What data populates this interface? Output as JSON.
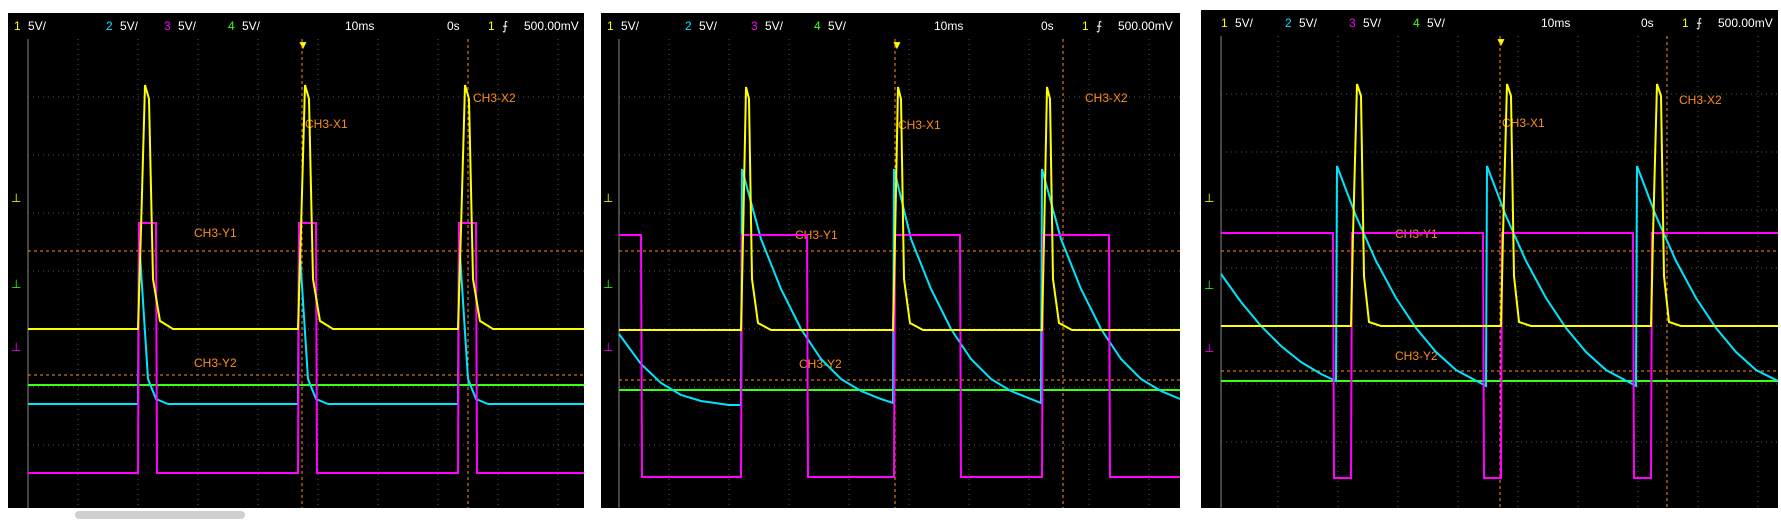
{
  "panels": [
    {
      "channels": [
        {
          "num": "1",
          "scale": "5V/"
        },
        {
          "num": "2",
          "scale": "5V/"
        },
        {
          "num": "3",
          "scale": "5V/"
        },
        {
          "num": "4",
          "scale": "5V/"
        }
      ],
      "timebase": "10ms",
      "delay": "0s",
      "trig_channel": "1",
      "trig_level": "500.00mV",
      "cursors": {
        "x1": "CH3-X1",
        "x2": "CH3-X2",
        "y1": "CH3-Y1",
        "y2": "CH3-Y2"
      }
    },
    {
      "channels": [
        {
          "num": "1",
          "scale": "5V/"
        },
        {
          "num": "2",
          "scale": "5V/"
        },
        {
          "num": "3",
          "scale": "5V/"
        },
        {
          "num": "4",
          "scale": "5V/"
        }
      ],
      "timebase": "10ms",
      "delay": "0s",
      "trig_channel": "1",
      "trig_level": "500.00mV",
      "cursors": {
        "x1": "CH3-X1",
        "x2": "CH3-X2",
        "y1": "CH3-Y1",
        "y2": "CH3-Y2"
      }
    },
    {
      "channels": [
        {
          "num": "1",
          "scale": "5V/"
        },
        {
          "num": "2",
          "scale": "5V/"
        },
        {
          "num": "3",
          "scale": "5V/"
        },
        {
          "num": "4",
          "scale": "5V/"
        }
      ],
      "timebase": "10ms",
      "delay": "0s",
      "trig_channel": "1",
      "trig_level": "500.00mV",
      "cursors": {
        "x1": "CH3-X1",
        "x2": "CH3-X2",
        "y1": "CH3-Y1",
        "y2": "CH3-Y2"
      }
    }
  ],
  "colors": {
    "ch1": "#ffff00",
    "ch2": "#00e5ff",
    "ch3": "#ff00ff",
    "ch4": "#39ff14",
    "cursor": "#ff8c1a",
    "grid": "#555555"
  }
}
